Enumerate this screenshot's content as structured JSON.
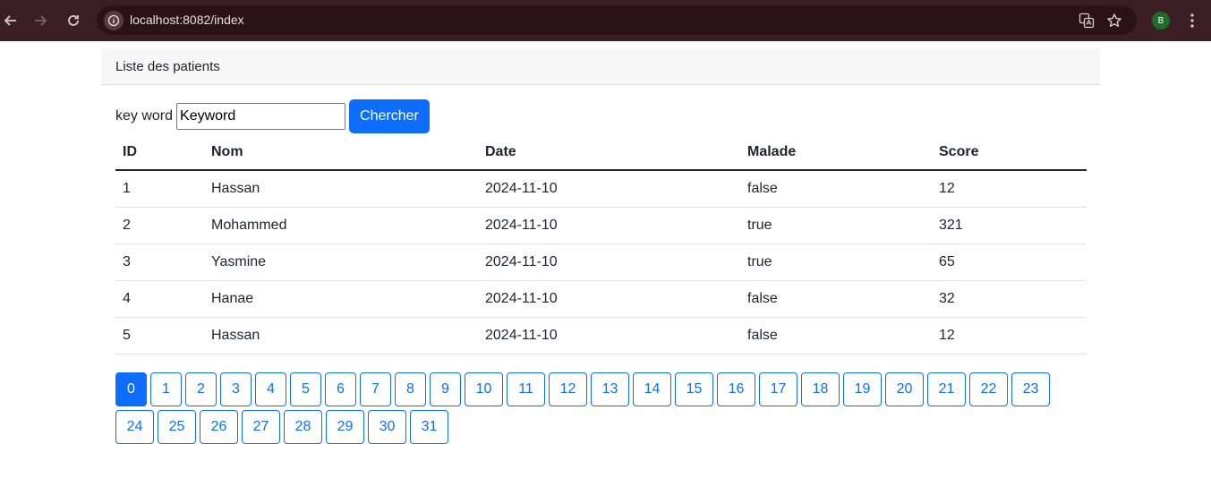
{
  "browser": {
    "url": "localhost:8082/index",
    "profile_initial": "B",
    "colors": {
      "frame": "#3c1f25",
      "omnibox": "#2a1217"
    }
  },
  "card": {
    "header": "Liste des patients"
  },
  "search": {
    "label": "key word",
    "value": "Keyword",
    "button_label": "Chercher"
  },
  "table": {
    "headers": [
      "ID",
      "Nom",
      "Date",
      "Malade",
      "Score"
    ],
    "rows": [
      [
        "1",
        "Hassan",
        "2024-11-10",
        "false",
        "12"
      ],
      [
        "2",
        "Mohammed",
        "2024-11-10",
        "true",
        "321"
      ],
      [
        "3",
        "Yasmine",
        "2024-11-10",
        "true",
        "65"
      ],
      [
        "4",
        "Hanae",
        "2024-11-10",
        "false",
        "32"
      ],
      [
        "5",
        "Hassan",
        "2024-11-10",
        "false",
        "12"
      ]
    ]
  },
  "pagination": {
    "pages": [
      "0",
      "1",
      "2",
      "3",
      "4",
      "5",
      "6",
      "7",
      "8",
      "9",
      "10",
      "11",
      "12",
      "13",
      "14",
      "15",
      "16",
      "17",
      "18",
      "19",
      "20",
      "21",
      "22",
      "23",
      "24",
      "25",
      "26",
      "27",
      "28",
      "29",
      "30",
      "31"
    ],
    "current": "0",
    "accent": "#0d6efd"
  }
}
